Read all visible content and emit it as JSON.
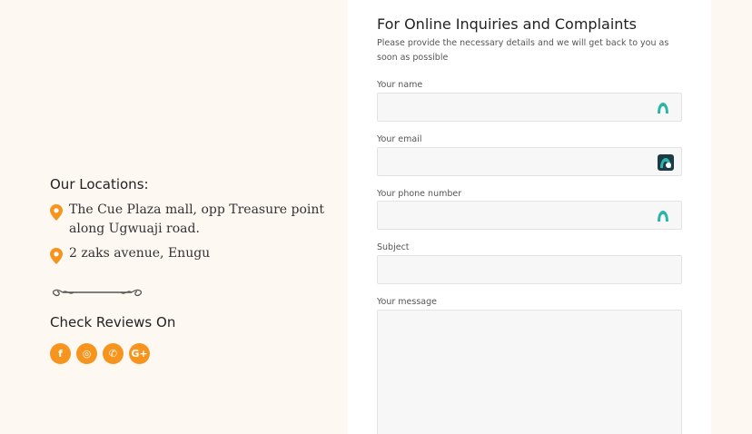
{
  "locations": {
    "heading": "Our Locations:",
    "items": [
      "The Cue Plaza mall, opp Treasure point along Ugwuaji road.",
      "2 zaks avenue, Enugu"
    ]
  },
  "reviews": {
    "heading": "Check Reviews On",
    "icons": [
      "facebook-icon",
      "instagram-icon",
      "whatsapp-icon",
      "google-plus-icon"
    ],
    "labels": [
      "f",
      "◎",
      "✆",
      "G+"
    ]
  },
  "form": {
    "title": "For Online Inquiries and Complaints",
    "subtitle": "Please provide the necessary details and we will get back to you as soon as possible",
    "name_label": "Your name",
    "email_label": "Your email",
    "phone_label": "Your phone number",
    "subject_label": "Subject",
    "message_label": "Your message",
    "name_value": "",
    "email_value": "",
    "phone_value": "",
    "subject_value": "",
    "message_value": ""
  },
  "colors": {
    "accent": "#f7941d",
    "background": "#fdf8f2",
    "autofill_teal": "#2bb5a8"
  }
}
